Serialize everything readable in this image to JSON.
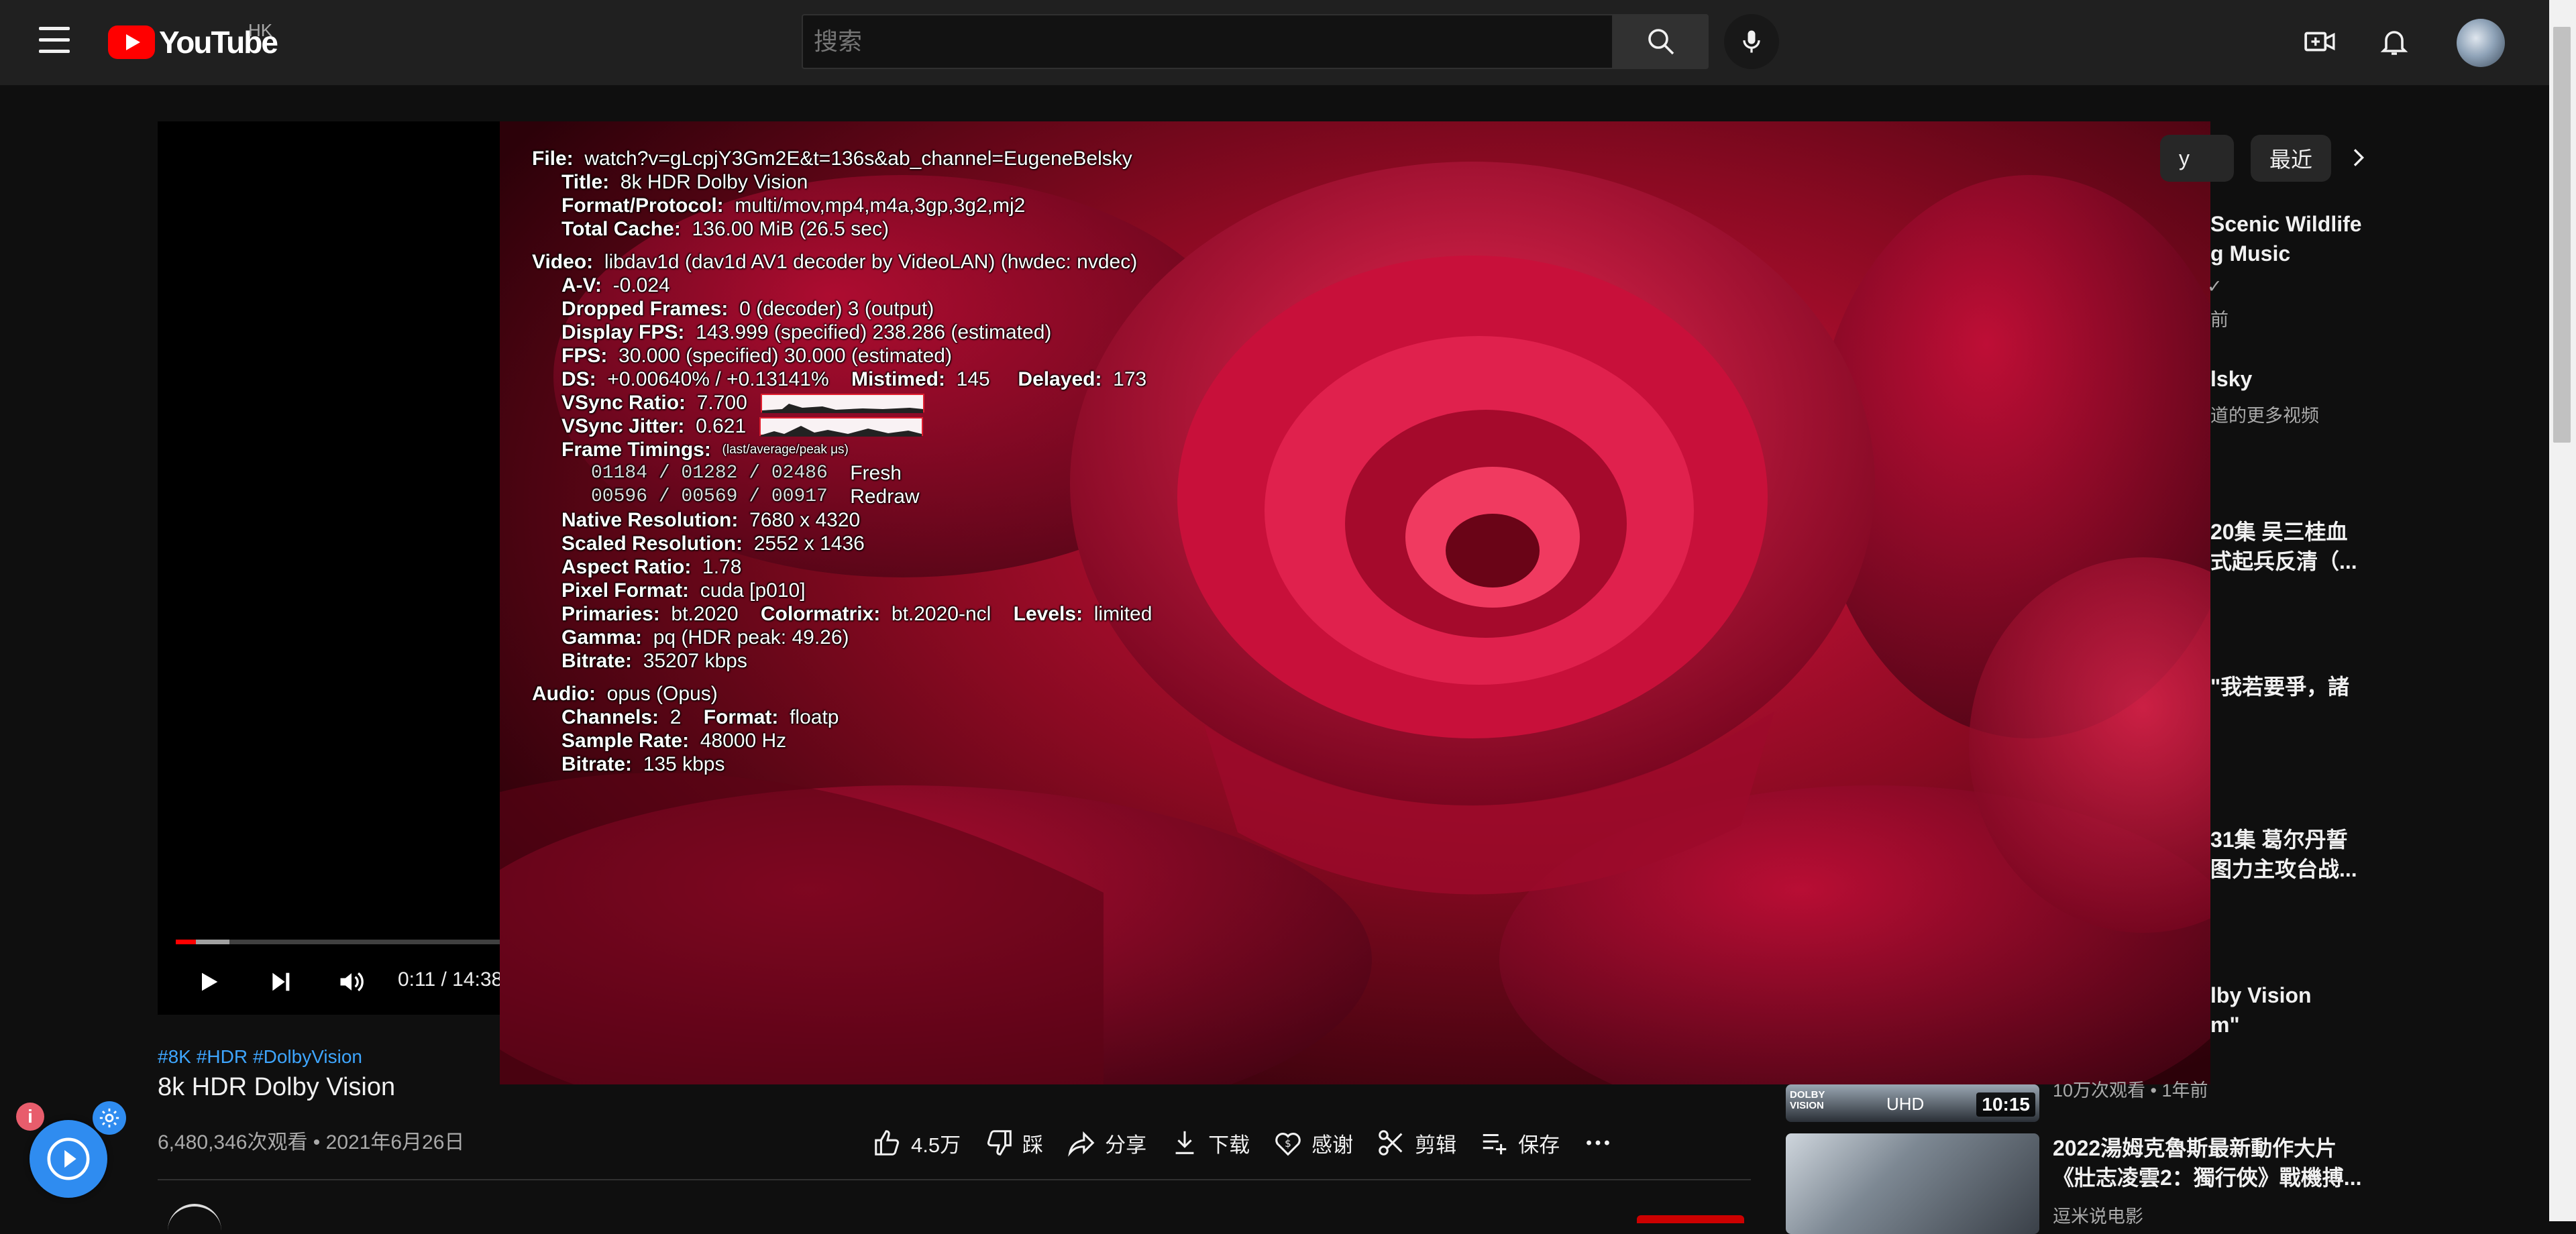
{
  "masthead": {
    "logo_text": "YouTube",
    "country_code": "HK",
    "search_placeholder": "搜索",
    "icons": [
      "menu-icon",
      "search-icon",
      "mic-icon",
      "create-video-icon",
      "bell-icon"
    ]
  },
  "player": {
    "time": "0:11 / 14:38",
    "progress_fraction": 0.0125
  },
  "stats": {
    "file_label": "File:",
    "file": "watch?v=gLcpjY3Gm2E&t=136s&ab_channel=EugeneBelsky",
    "title_label": "Title:",
    "title": "8k HDR Dolby Vision",
    "format_label": "Format/Protocol:",
    "format": "multi/mov,mp4,m4a,3gp,3g2,mj2",
    "cache_label": "Total Cache:",
    "cache": "136.00 MiB  (26.5 sec)",
    "video_label": "Video:",
    "video": "libdav1d (dav1d AV1 decoder by VideoLAN) (hwdec:  nvdec)",
    "av_label": "A-V:",
    "av": "-0.024",
    "dropped_label": "Dropped Frames:",
    "dropped": "0 (decoder)  3 (output)",
    "dfps_label": "Display FPS:",
    "dfps": "143.999 (specified)  238.286 (estimated)",
    "fps_label": "FPS:",
    "fps": "30.000 (specified)  30.000 (estimated)",
    "ds_label": "DS:",
    "ds": "+0.00640% / +0.13141%",
    "mistimed_label": "Mistimed:",
    "mistimed": "145",
    "delayed_label": "Delayed:",
    "delayed": "173",
    "vsync_ratio_label": "VSync Ratio:",
    "vsync_ratio": "7.700",
    "vsync_jitter_label": "VSync Jitter:",
    "vsync_jitter": "0.621",
    "frame_timings_label": "Frame Timings:",
    "frame_timings_unit": "(last/average/peak  μs)",
    "fresh_values": "01184 / 01282 / 02486",
    "fresh_label": "Fresh",
    "redraw_values": "00596 / 00569 / 00917",
    "redraw_label": "Redraw",
    "native_res_label": "Native Resolution:",
    "native_res": "7680 x 4320",
    "scaled_res_label": "Scaled Resolution:",
    "scaled_res": "2552 x 1436",
    "aspect_label": "Aspect Ratio:",
    "aspect": "1.78",
    "pixfmt_label": "Pixel Format:",
    "pixfmt": "cuda [p010]",
    "primaries_label": "Primaries:",
    "primaries": "bt.2020",
    "colormatrix_label": "Colormatrix:",
    "colormatrix": "bt.2020-ncl",
    "levels_label": "Levels:",
    "levels": "limited",
    "gamma_label": "Gamma:",
    "gamma": "pq (HDR peak: 49.26)",
    "vbitrate_label": "Bitrate:",
    "vbitrate": "35207 kbps",
    "audio_label": "Audio:",
    "audio": "opus (Opus)",
    "channels_label": "Channels:",
    "channels": "2",
    "aformat_label": "Format:",
    "aformat": "floatp",
    "samplerate_label": "Sample Rate:",
    "samplerate": "48000 Hz",
    "abitrate_label": "Bitrate:",
    "abitrate": "135 kbps"
  },
  "video": {
    "hashtags": [
      "#8K",
      "#HDR",
      "#DolbyVision"
    ],
    "title": "8k HDR Dolby Vision",
    "meta": "6,480,346次观看 • 2021年6月26日",
    "actions": {
      "like": "4.5万",
      "dislike": "踩",
      "share": "分享",
      "download": "下载",
      "thanks": "感谢",
      "clip": "剪辑",
      "save": "保存"
    }
  },
  "sidebar": {
    "chips": [
      "y",
      "最近"
    ],
    "items": [
      {
        "title1": "Scenic Wildlife",
        "title2": "g Music",
        "sub1": "✓",
        "sub2": "前"
      },
      {
        "title1": "lsky",
        "sub1": "道的更多视频"
      },
      {
        "title1": "20集 吴三桂血",
        "title2": "式起兵反清（..."
      },
      {
        "title1": "\"我若要爭，諸"
      },
      {
        "title1": "31集 葛尔丹誓",
        "title2": "图力主攻台战..."
      },
      {
        "title1": "lby Vision",
        "title2": "m\""
      },
      {
        "meta": "10万次观看 • 1年前",
        "thumb_label": "DOLBY VISION",
        "thumb_tag": "UHD",
        "duration": "10:15"
      },
      {
        "title1": "2022湯姆克魯斯最新動作大片",
        "title2": "《壯志凌雲2：獨行俠》戰機搏...",
        "sub1": "逗米说电影"
      }
    ]
  },
  "colors": {
    "background": "#0f0f0f",
    "masthead": "#202020",
    "accent_red": "#ff0000",
    "link_blue": "#3ea6ff"
  }
}
